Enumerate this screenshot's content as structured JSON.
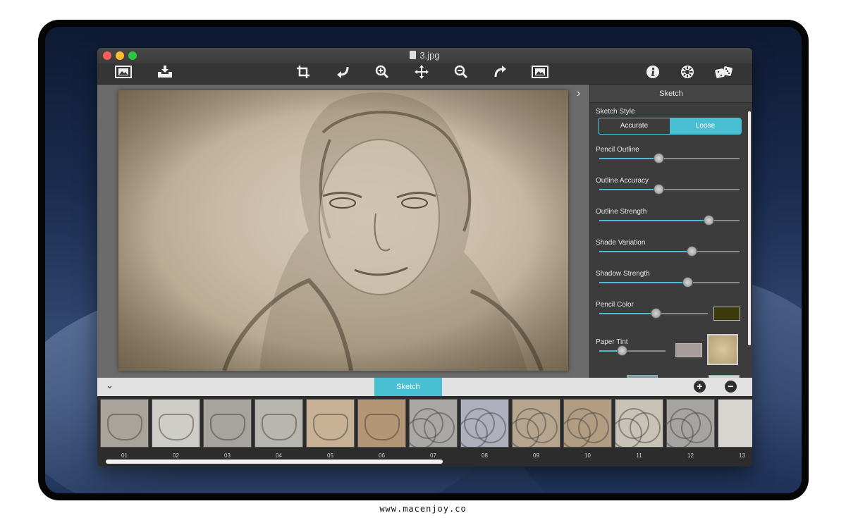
{
  "window": {
    "title": "3.jpg"
  },
  "toolbar": {
    "left": [
      {
        "icon": "open-image-icon"
      },
      {
        "icon": "save-icon"
      }
    ],
    "center": [
      {
        "icon": "crop-icon"
      },
      {
        "icon": "rotate-left-icon"
      },
      {
        "icon": "zoom-in-icon"
      },
      {
        "icon": "move-icon"
      },
      {
        "icon": "zoom-out-icon"
      },
      {
        "icon": "rotate-right-icon"
      },
      {
        "icon": "fit-image-icon"
      }
    ],
    "right": [
      {
        "icon": "info-icon"
      },
      {
        "icon": "settings-icon"
      },
      {
        "icon": "dice-icon"
      }
    ]
  },
  "panel": {
    "title": "Sketch",
    "sketch_style": {
      "label": "Sketch Style",
      "options": [
        "Accurate",
        "Loose"
      ],
      "selected": "Loose"
    },
    "sliders": [
      {
        "label": "Pencil Outline",
        "value": 0.42
      },
      {
        "label": "Outline Accuracy",
        "value": 0.42
      },
      {
        "label": "Outline Strength",
        "value": 0.78
      },
      {
        "label": "Shade Variation",
        "value": 0.66
      },
      {
        "label": "Shadow Strength",
        "value": 0.63
      }
    ],
    "pencil_color": {
      "label": "Pencil Color",
      "value": 0.52,
      "color": "#3a3a0a"
    },
    "paper_tint": {
      "label": "Paper Tint",
      "value": 0.34,
      "color": "#a89c9a"
    }
  },
  "strip": {
    "tab_label": "Sketch",
    "thumbs": [
      "01",
      "02",
      "03",
      "04",
      "05",
      "06",
      "07",
      "08",
      "09",
      "10",
      "11",
      "12",
      "13"
    ]
  },
  "footer": {
    "watermark": "www.macenjoy.co"
  },
  "colors": {
    "accent": "#49bfd4"
  }
}
